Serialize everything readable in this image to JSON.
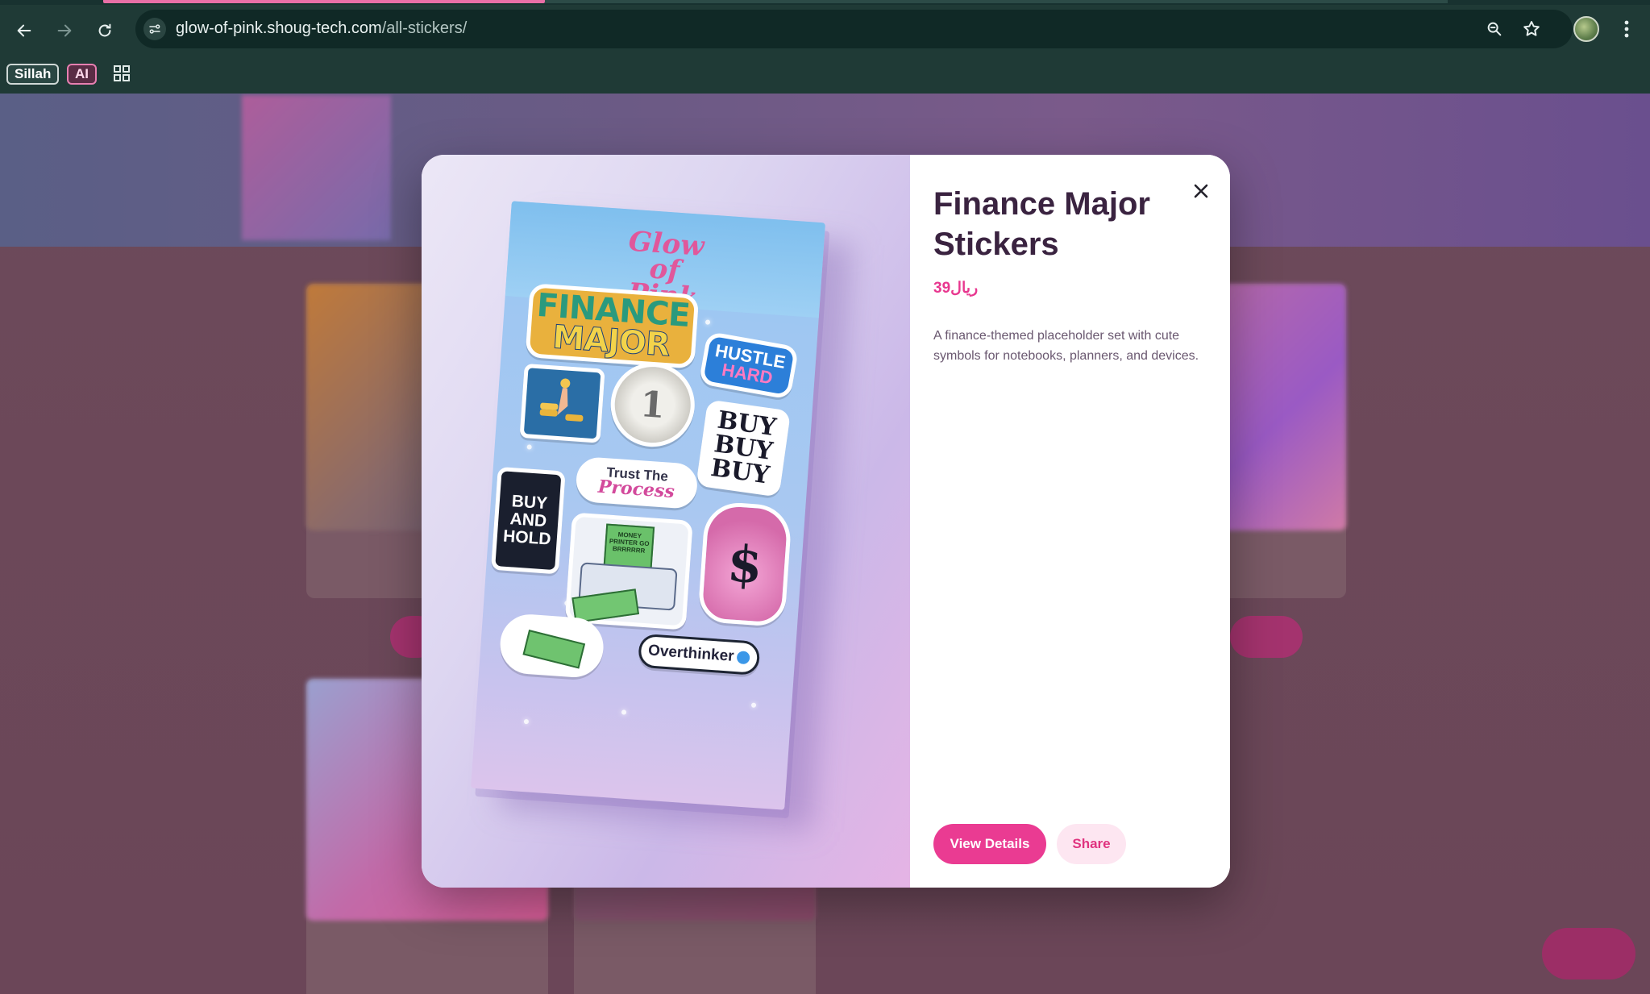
{
  "browser": {
    "url_host": "glow-of-pink.shoug-tech.com",
    "url_path": "/all-stickers/",
    "icons": [
      "back-icon",
      "forward-icon",
      "reload-icon",
      "site-info-icon",
      "zoom-icon",
      "bookmark-star-icon",
      "profile-avatar",
      "more-menu-icon",
      "apps-grid-icon"
    ]
  },
  "bookmarks": {
    "sillah": "Sillah",
    "ai": "AI"
  },
  "modal": {
    "title": "Finance Major Stickers",
    "price": "39ريال",
    "description": "A finance-themed placeholder set with cute symbols for notebooks, planners, and devices.",
    "close_label": "×",
    "view_details": "View Details",
    "share": "Share"
  },
  "sticker_sheet": {
    "brand": "Glow of Pink",
    "stickers": {
      "finance_major_l1": "FINANCE",
      "finance_major_l2": "MAJOR",
      "hustle_l1": "HUSTLE",
      "hustle_l2": "HARD",
      "coin": "1",
      "buy": "BUY BUY BUY",
      "trust_l1": "Trust The",
      "trust_l2": "Process",
      "hold": "BUY AND HOLD",
      "printer": "MONEY PRINTER GO BRRRRRR",
      "bag": "$",
      "overthinker": "Overthinker"
    }
  },
  "colors": {
    "accent": "#ea3b92",
    "accent_soft": "#fde6f1",
    "title": "#3a2340",
    "chrome": "#1f3a36"
  }
}
